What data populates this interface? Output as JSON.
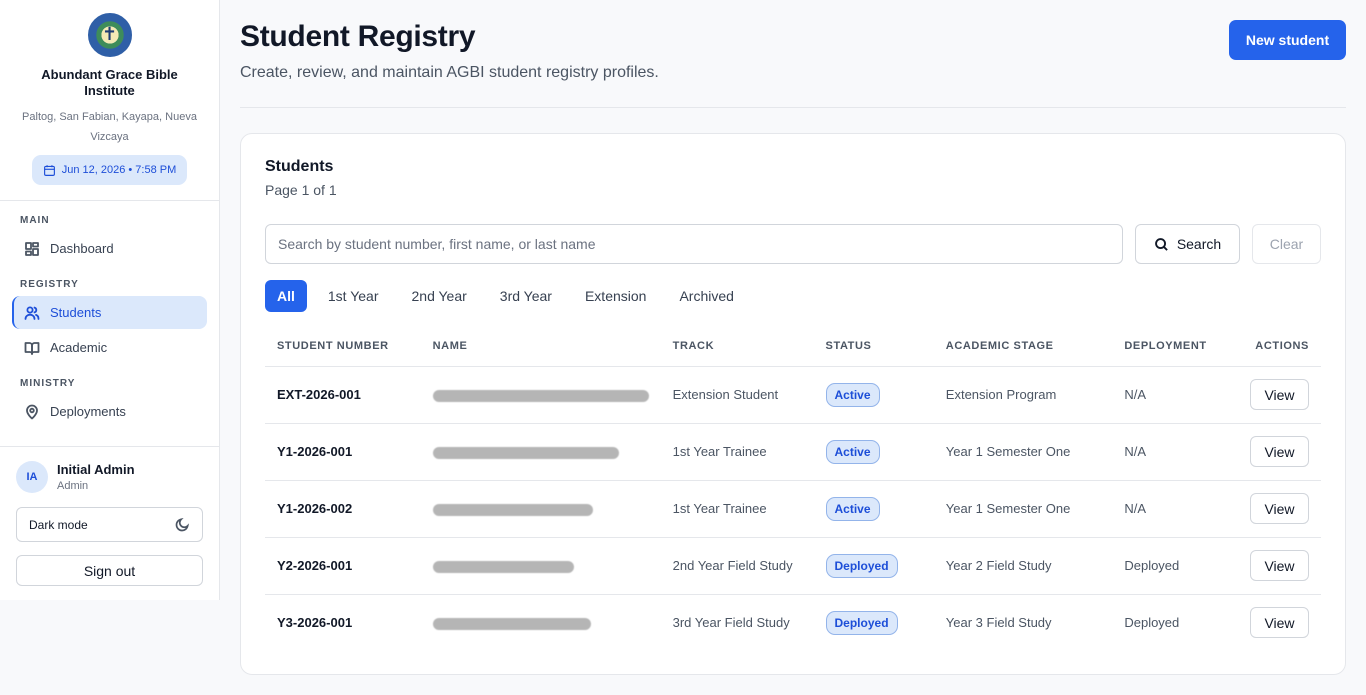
{
  "sidebar": {
    "institute_name": "Abundant Grace Bible Institute",
    "address": "Paltog, San Fabian, Kayapa, Nueva Vizcaya",
    "datetime": "Jun 12, 2026 • 7:58 PM",
    "sections": [
      {
        "label": "MAIN",
        "items": [
          {
            "label": "Dashboard",
            "icon": "dashboard-icon"
          }
        ]
      },
      {
        "label": "REGISTRY",
        "items": [
          {
            "label": "Students",
            "icon": "users-icon",
            "active": true
          },
          {
            "label": "Academic",
            "icon": "book-icon"
          }
        ]
      },
      {
        "label": "MINISTRY",
        "items": [
          {
            "label": "Deployments",
            "icon": "map-pin-icon"
          }
        ]
      }
    ],
    "user": {
      "initials": "IA",
      "name": "Initial Admin",
      "role": "Admin"
    },
    "dark_mode_label": "Dark mode",
    "sign_out_label": "Sign out"
  },
  "header": {
    "title": "Student Registry",
    "subtitle": "Create, review, and maintain AGBI student registry profiles.",
    "new_button": "New student"
  },
  "card": {
    "title": "Students",
    "pagination": "Page 1 of 1",
    "search_placeholder": "Search by student number, first name, or last name",
    "search_value": "",
    "search_button": "Search",
    "clear_button": "Clear",
    "tabs": [
      "All",
      "1st Year",
      "2nd Year",
      "3rd Year",
      "Extension",
      "Archived"
    ],
    "active_tab": "All",
    "columns": [
      "STUDENT NUMBER",
      "NAME",
      "TRACK",
      "STATUS",
      "ACADEMIC STAGE",
      "DEPLOYMENT",
      "ACTIONS"
    ],
    "rows": [
      {
        "number": "EXT-2026-001",
        "track": "Extension Student",
        "status": "Active",
        "stage": "Extension Program",
        "deployment": "N/A",
        "action": "View"
      },
      {
        "number": "Y1-2026-001",
        "track": "1st Year Trainee",
        "status": "Active",
        "stage": "Year 1 Semester One",
        "deployment": "N/A",
        "action": "View"
      },
      {
        "number": "Y1-2026-002",
        "track": "1st Year Trainee",
        "status": "Active",
        "stage": "Year 1 Semester One",
        "deployment": "N/A",
        "action": "View"
      },
      {
        "number": "Y2-2026-001",
        "track": "2nd Year Field Study",
        "status": "Deployed",
        "stage": "Year 2 Field Study",
        "deployment": "Deployed",
        "action": "View"
      },
      {
        "number": "Y3-2026-001",
        "track": "3rd Year Field Study",
        "status": "Deployed",
        "stage": "Year 3 Field Study",
        "deployment": "Deployed",
        "action": "View"
      }
    ]
  },
  "colors": {
    "accent": "#2563eb",
    "accent_light": "#dbe8fb",
    "border": "#e5e7eb"
  }
}
